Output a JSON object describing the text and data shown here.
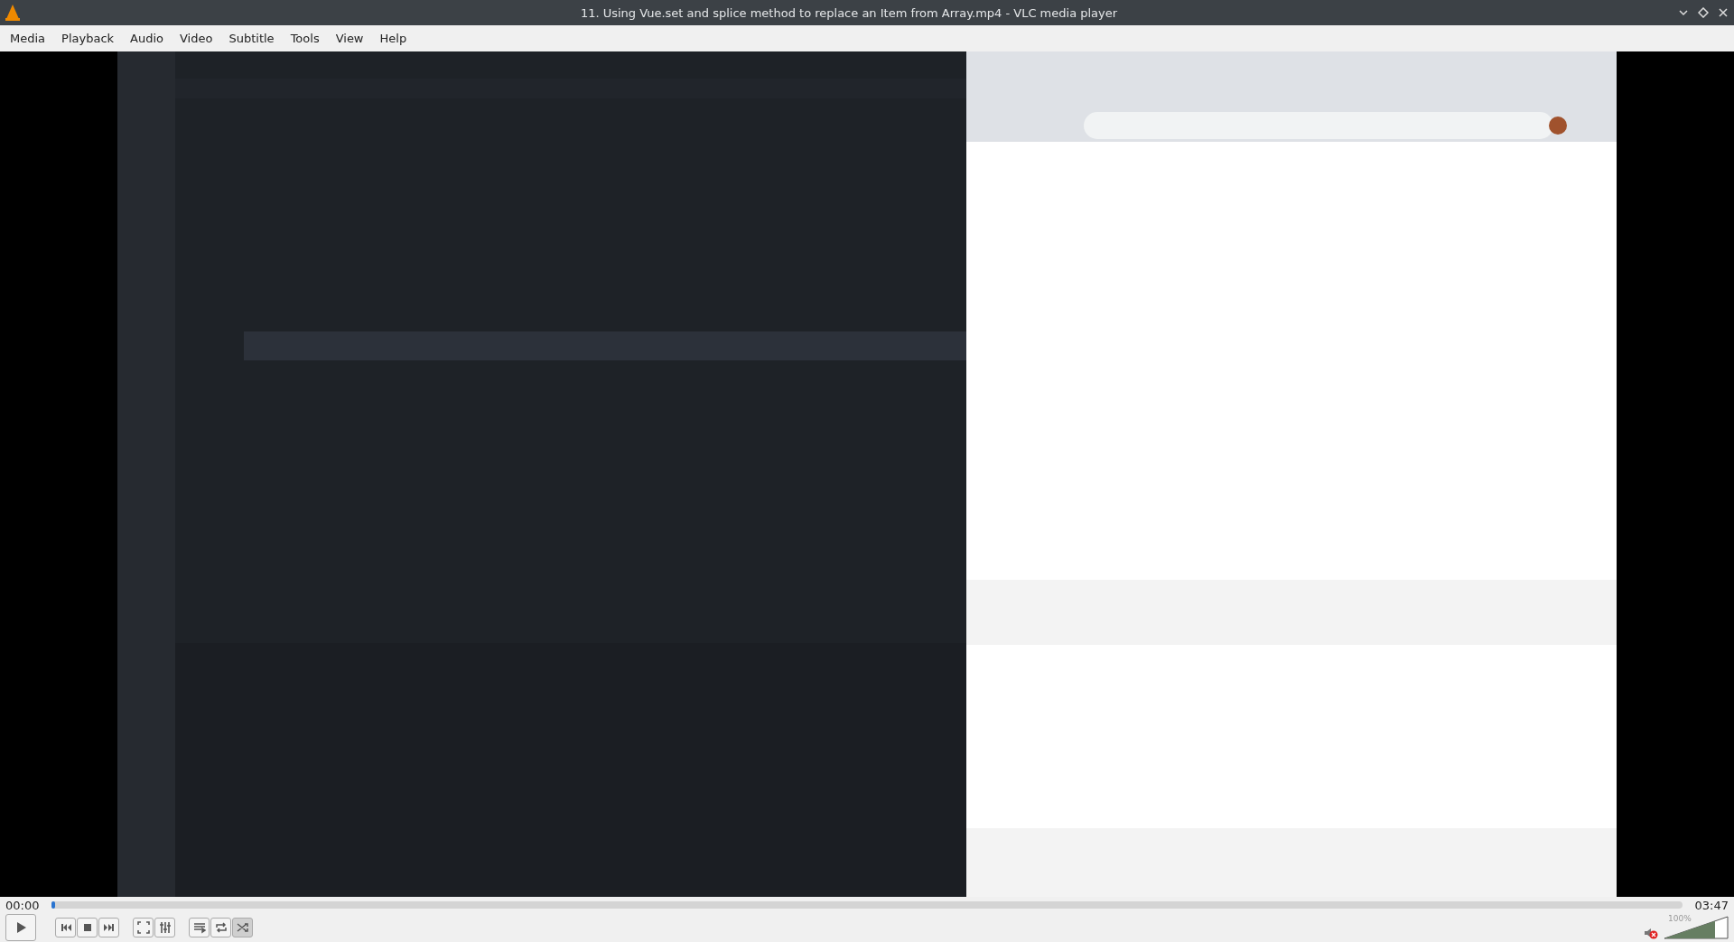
{
  "window": {
    "title": "11. Using Vue.set and splice method to replace an Item from Array.mp4 - VLC media player"
  },
  "menu": [
    "Media",
    "Playback",
    "Audio",
    "Video",
    "Subtitle",
    "Tools",
    "View",
    "Help"
  ],
  "seek": {
    "elapsed": "00:00",
    "total": "03:47",
    "level": 0.002
  },
  "controls": {
    "random": true
  },
  "volume": {
    "muted": true,
    "reading": "100%",
    "level": 0.8
  }
}
